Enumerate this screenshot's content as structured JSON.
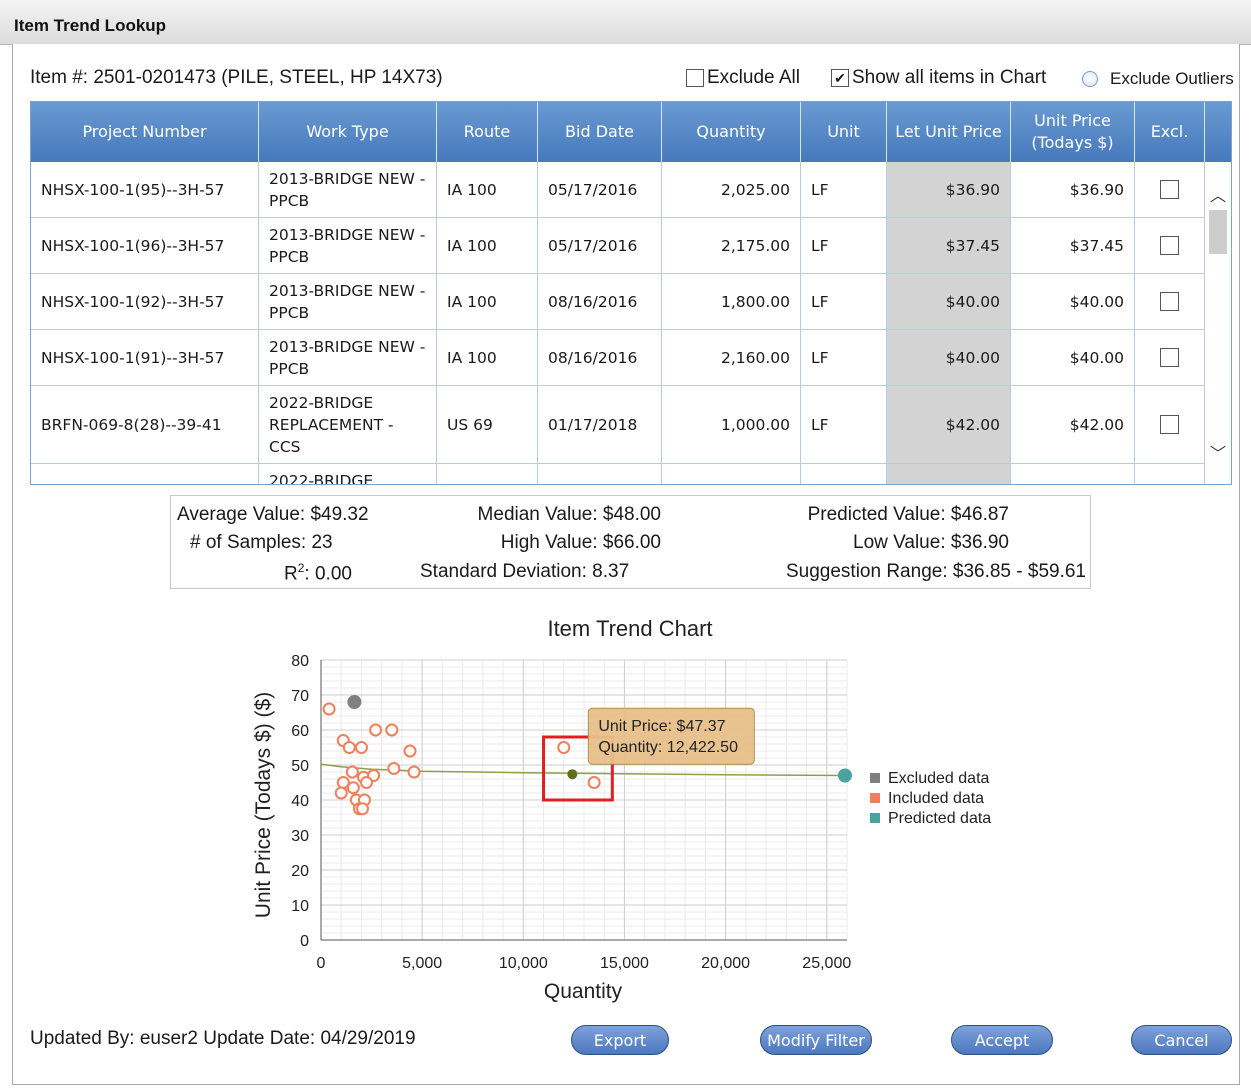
{
  "window": {
    "title": "Item Trend Lookup"
  },
  "item": {
    "label": "Item #: 2501-0201473 (PILE, STEEL, HP 14X73)"
  },
  "options": {
    "exclude_all": {
      "label": "Exclude All",
      "checked": false
    },
    "show_all": {
      "label": "Show all items in Chart",
      "checked": true
    },
    "exclude_outliers": {
      "label": "Exclude Outliers",
      "selected": false
    }
  },
  "table": {
    "columns": [
      "Project Number",
      "Work Type",
      "Route",
      "Bid Date",
      "Quantity",
      "Unit",
      "Let Unit Price",
      "Unit Price (Todays $)",
      "Excl."
    ],
    "rows": [
      {
        "project": "NHSX-100-1(95)--3H-57",
        "work_type": "2013-BRIDGE NEW - PPCB",
        "route": "IA 100",
        "bid_date": "05/17/2016",
        "quantity": "2,025.00",
        "unit": "LF",
        "let_price": "$36.90",
        "unit_price": "$36.90",
        "excl": false
      },
      {
        "project": "NHSX-100-1(96)--3H-57",
        "work_type": "2013-BRIDGE NEW - PPCB",
        "route": "IA 100",
        "bid_date": "05/17/2016",
        "quantity": "2,175.00",
        "unit": "LF",
        "let_price": "$37.45",
        "unit_price": "$37.45",
        "excl": false
      },
      {
        "project": "NHSX-100-1(92)--3H-57",
        "work_type": "2013-BRIDGE NEW - PPCB",
        "route": "IA 100",
        "bid_date": "08/16/2016",
        "quantity": "1,800.00",
        "unit": "LF",
        "let_price": "$40.00",
        "unit_price": "$40.00",
        "excl": false
      },
      {
        "project": "NHSX-100-1(91)--3H-57",
        "work_type": "2013-BRIDGE NEW - PPCB",
        "route": "IA 100",
        "bid_date": "08/16/2016",
        "quantity": "2,160.00",
        "unit": "LF",
        "let_price": "$40.00",
        "unit_price": "$40.00",
        "excl": false
      },
      {
        "project": "BRFN-069-8(28)--39-41",
        "work_type": "2022-BRIDGE REPLACEMENT - CCS",
        "route": "US 69",
        "bid_date": "01/17/2018",
        "quantity": "1,000.00",
        "unit": "LF",
        "let_price": "$42.00",
        "unit_price": "$42.00",
        "excl": false
      }
    ],
    "partial_row_text": "2022-BRIDGE"
  },
  "stats": {
    "average": "Average Value: $49.32",
    "median": "Median Value: $48.00",
    "predicted": "Predicted Value: $46.87",
    "samples": "# of Samples: 23",
    "high": "High Value: $66.00",
    "low": "Low Value: $36.90",
    "r2_label": "R",
    "r2_sup": "2",
    "r2_value": ": 0.00",
    "stddev": "Standard Deviation: 8.37",
    "range": "Suggestion Range: $36.85 - $59.61"
  },
  "chart_data": {
    "type": "scatter",
    "title": "Item Trend Chart",
    "xlabel": "Quantity",
    "ylabel": "Unit Price (Todays $) ($)",
    "xlim": [
      0,
      26000
    ],
    "ylim": [
      0,
      80
    ],
    "xticks": [
      "0",
      "5,000",
      "10,000",
      "15,000",
      "20,000",
      "25,000"
    ],
    "xtick_values": [
      0,
      5000,
      10000,
      15000,
      20000,
      25000
    ],
    "yticks": [
      0,
      10,
      20,
      30,
      40,
      50,
      60,
      70,
      80
    ],
    "grid": true,
    "legend_position": "right",
    "series": [
      {
        "name": "Excluded data",
        "color": "#808080",
        "marker": "filled-circle",
        "points": [
          [
            1650,
            68
          ]
        ]
      },
      {
        "name": "Included data",
        "color": "#f07f5b",
        "marker": "open-circle",
        "points": [
          [
            400,
            66
          ],
          [
            1100,
            57
          ],
          [
            1400,
            55
          ],
          [
            2000,
            55
          ],
          [
            2700,
            60
          ],
          [
            3500,
            60
          ],
          [
            4400,
            54
          ],
          [
            3600,
            49
          ],
          [
            4600,
            48
          ],
          [
            1550,
            48
          ],
          [
            2100,
            46.5
          ],
          [
            2600,
            47
          ],
          [
            1100,
            45
          ],
          [
            2250,
            45
          ],
          [
            1600,
            43.5
          ],
          [
            1000,
            42
          ],
          [
            1750,
            40
          ],
          [
            2150,
            40
          ],
          [
            1900,
            37.5
          ],
          [
            2050,
            37.5
          ],
          [
            12000,
            55
          ],
          [
            13500,
            45
          ]
        ]
      },
      {
        "name": "Predicted data",
        "color": "#4aa3a0",
        "marker": "filled-circle",
        "points": [
          [
            25900,
            47
          ]
        ]
      }
    ],
    "trendline": {
      "color": "#8aa04a",
      "points": [
        [
          0,
          50.2
        ],
        [
          1000,
          49.5
        ],
        [
          2500,
          48.8
        ],
        [
          5000,
          48.2
        ],
        [
          10000,
          47.8
        ],
        [
          15000,
          47.5
        ],
        [
          20000,
          47.2
        ],
        [
          26000,
          47.0
        ]
      ]
    },
    "highlight_point": {
      "x": 12422.5,
      "y": 47.37,
      "color": "#5f6f1a"
    },
    "tooltip": {
      "line1": "Unit Price: $47.37",
      "line2": "Quantity: 12,422.50"
    },
    "selection_box": {
      "x": [
        11000,
        14400
      ],
      "y": [
        40,
        58
      ],
      "color": "#e02020"
    }
  },
  "footer": {
    "updated": "Updated By: euser2 Update Date: 04/29/2019",
    "buttons": {
      "export": "Export",
      "modify": "Modify Filter",
      "accept": "Accept",
      "cancel": "Cancel"
    }
  }
}
